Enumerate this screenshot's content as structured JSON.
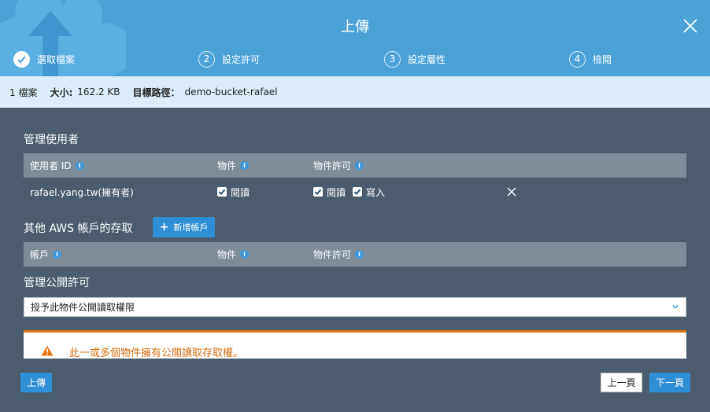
{
  "header": {
    "title": "上傳",
    "steps": [
      {
        "label": "選取檔案",
        "number": ""
      },
      {
        "label": "設定許可",
        "number": "2"
      },
      {
        "label": "設定屬性",
        "number": "3"
      },
      {
        "label": "檢閱",
        "number": "4"
      }
    ]
  },
  "infobar": {
    "files": "1 檔案",
    "size_label": "大小:",
    "size_value": "162.2 KB",
    "path_label": "目標路徑：",
    "path_value": "demo-bucket-rafael"
  },
  "users": {
    "title": "管理使用者",
    "columns": [
      "使用者 ID",
      "物件",
      "物件許可"
    ],
    "rows": [
      {
        "user": "rafael.yang.tw(擁有者)",
        "object_read": "閱讀",
        "perm_read": "閱讀",
        "perm_write": "寫入"
      }
    ]
  },
  "other_accounts": {
    "title": "其他 AWS 帳戶的存取",
    "add_label": "新增帳戶",
    "columns": [
      "帳戶",
      "物件",
      "物件許可"
    ]
  },
  "public": {
    "title": "管理公開許可",
    "selected": "授予此物件公開讀取權限",
    "warning": "此一或多個物件擁有公開讀取存取權。"
  },
  "footer": {
    "upload": "上傳",
    "prev": "上一頁",
    "next": "下一頁"
  },
  "colors": {
    "header": "#4aa2d9",
    "body": "#4b5d6c",
    "accent": "#2f8fd6",
    "warning": "#e67613"
  }
}
